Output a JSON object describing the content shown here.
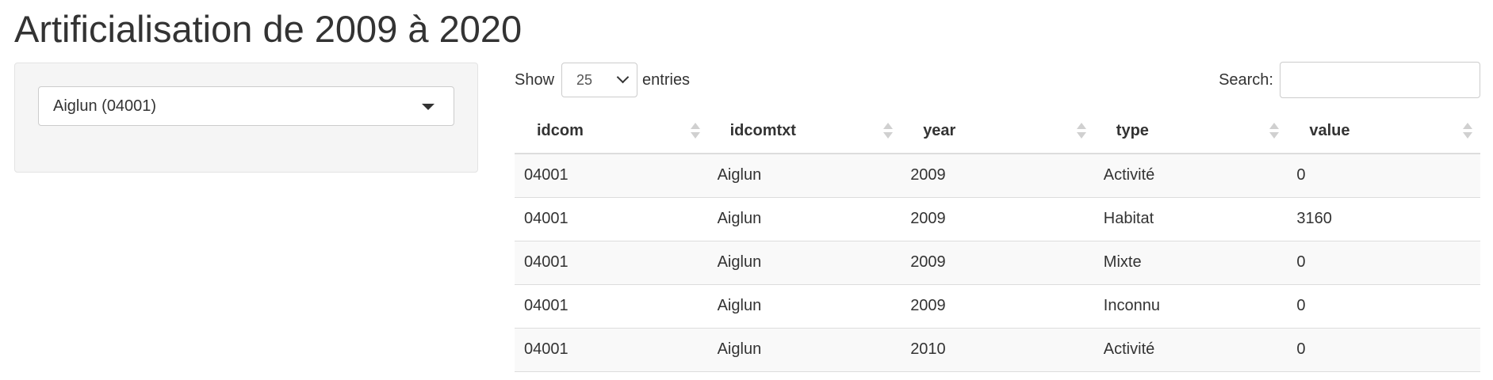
{
  "page": {
    "title": "Artificialisation de 2009 à 2020"
  },
  "sidebar": {
    "commune_select": {
      "value": "Aiglun (04001)"
    }
  },
  "table_controls": {
    "show_label": "Show",
    "length_value": "25",
    "entries_label": "entries",
    "search_label": "Search:",
    "search_value": ""
  },
  "table": {
    "columns": [
      "idcom",
      "idcomtxt",
      "year",
      "type",
      "value"
    ],
    "rows": [
      [
        "04001",
        "Aiglun",
        "2009",
        "Activité",
        "0"
      ],
      [
        "04001",
        "Aiglun",
        "2009",
        "Habitat",
        "3160"
      ],
      [
        "04001",
        "Aiglun",
        "2009",
        "Mixte",
        "0"
      ],
      [
        "04001",
        "Aiglun",
        "2009",
        "Inconnu",
        "0"
      ],
      [
        "04001",
        "Aiglun",
        "2010",
        "Activité",
        "0"
      ]
    ]
  },
  "icons": {
    "dropdown": "caret-down-icon",
    "length_chevron": "chevron-down-icon",
    "sort": "sort-both-icon"
  },
  "colors": {
    "text": "#333333",
    "panel_background": "#f5f5f5",
    "striped_row": "#f9f9f9",
    "border": "#dddddd"
  }
}
